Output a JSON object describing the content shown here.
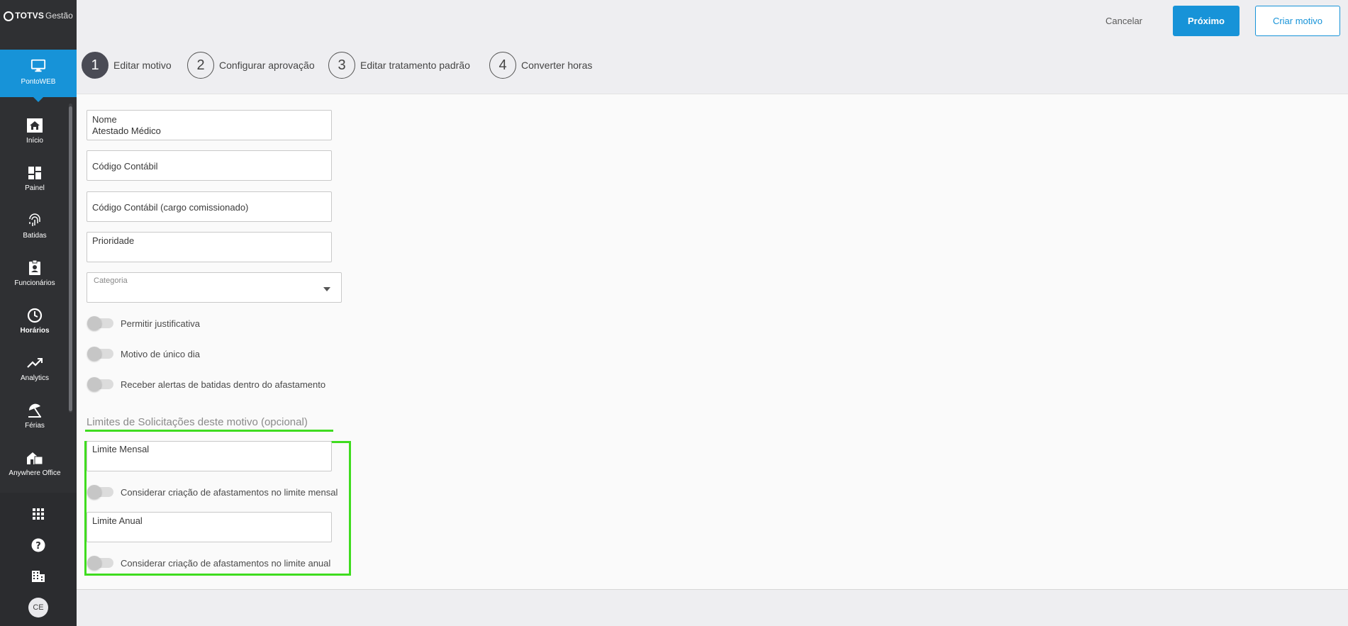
{
  "brand": {
    "name_bold": "TOTVS",
    "name_light": "Gestão"
  },
  "module": {
    "label": "PontoWEB",
    "icon": "monitor-icon"
  },
  "nav": [
    {
      "label": "Início",
      "icon": "home-icon"
    },
    {
      "label": "Painel",
      "icon": "dashboard-icon"
    },
    {
      "label": "Batidas",
      "icon": "fingerprint-icon"
    },
    {
      "label": "Funcionários",
      "icon": "badge-icon"
    },
    {
      "label": "Horários",
      "icon": "clock-icon"
    },
    {
      "label": "Analytics",
      "icon": "trending-icon"
    },
    {
      "label": "Férias",
      "icon": "beach-umbrella-icon"
    },
    {
      "label": "Anywhere Office",
      "icon": "home-office-icon"
    }
  ],
  "rail": {
    "apps_icon": "apps-grid-icon",
    "help_icon": "help-icon",
    "company_icon": "building-icon",
    "avatar_initials": "CE"
  },
  "header": {
    "cancel": "Cancelar",
    "next": "Próximo",
    "create": "Criar motivo"
  },
  "steps": [
    {
      "num": "1",
      "label": "Editar motivo"
    },
    {
      "num": "2",
      "label": "Configurar aprovação"
    },
    {
      "num": "3",
      "label": "Editar tratamento padrão"
    },
    {
      "num": "4",
      "label": "Converter horas"
    }
  ],
  "form": {
    "name_label": "Nome",
    "name_value": "Atestado Médico",
    "account_label": "Código Contábil",
    "account_comm_label": "Código Contábil (cargo comissionado)",
    "priority_label": "Prioridade",
    "category_label": "Categoria",
    "toggle_justify": "Permitir justificativa",
    "toggle_single_day": "Motivo de único dia",
    "toggle_alerts": "Receber alertas de batidas dentro do afastamento"
  },
  "limits": {
    "title": "Limites de Solicitações deste motivo (opcional)",
    "monthly_label": "Limite Mensal",
    "monthly_toggle": "Considerar criação de afastamentos no limite mensal",
    "annual_label": "Limite Anual",
    "annual_toggle": "Considerar criação de afastamentos no limite anual"
  },
  "colors": {
    "accent": "#1793d8",
    "sidebar": "#2f3033",
    "highlight": "#3fdc1f"
  }
}
